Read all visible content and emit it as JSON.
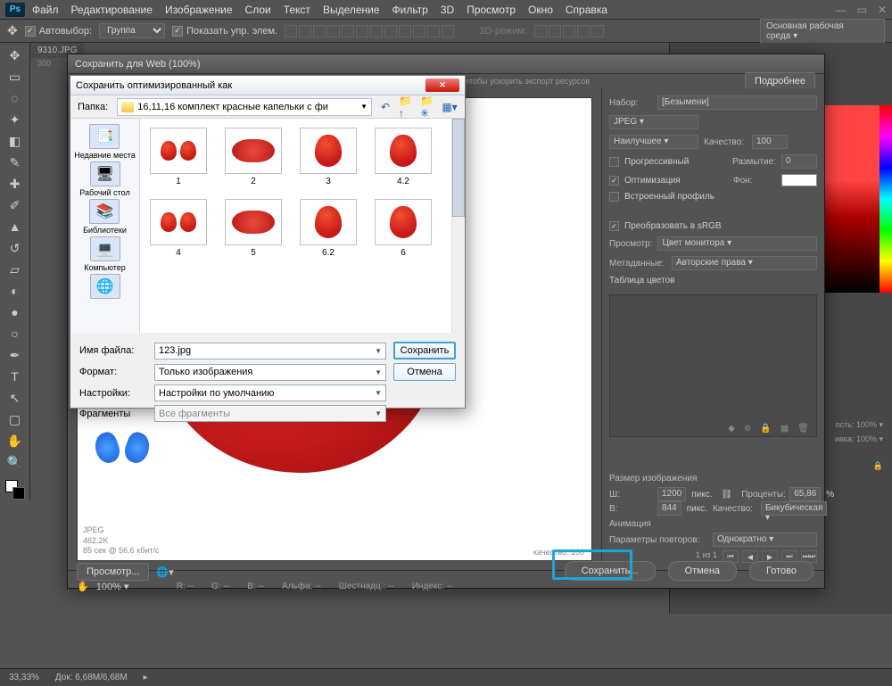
{
  "menu": [
    "Файл",
    "Редактирование",
    "Изображение",
    "Слои",
    "Текст",
    "Выделение",
    "Фильтр",
    "3D",
    "Просмотр",
    "Окно",
    "Справка"
  ],
  "optionsBar": {
    "autoselect": "Автовыбор:",
    "group": "Группа",
    "showControls": "Показать упр. элем.",
    "mode3d": "3D-режим:"
  },
  "workspace": "Основная рабочая среда",
  "docTab": "9310.JPG",
  "ruler": "300",
  "statusbar": {
    "zoom": "33,33%",
    "doc": "Док: 6,68M/6,68M"
  },
  "sfw": {
    "title": "Сохранить для Web (100%)",
    "meta": {
      "fmt": "JPEG",
      "size": "462,2K",
      "time": "85 сек @ 56.6 кбит/с"
    },
    "quality_lbl": "качество: 100",
    "zoom_lbl": "100%",
    "readouts": {
      "r": "R: --",
      "g": "G: --",
      "b": "B: --",
      "alpha": "Альфа: --",
      "hex": "Шестнадц.: --",
      "idx": "Индекс: --"
    },
    "footBtns": {
      "preview": "Просмотр...",
      "save": "Сохранить...",
      "cancel": "Отмена",
      "done": "Готово"
    },
    "side": {
      "preset_lbl": "Набор:",
      "preset_val": "[Безымени]",
      "format": "JPEG",
      "quality_mode": "Наилучшее",
      "quality_lbl2": "Качество:",
      "quality_val": "100",
      "progressive": "Прогрессивный",
      "blur_lbl": "Размытие:",
      "blur_val": "0",
      "optimized": "Оптимизация",
      "matte_lbl": "Фон:",
      "embed": "Встроенный профиль",
      "srgb": "Преобразовать в sRGB",
      "preview_lbl": "Просмотр:",
      "preview_val": "Цвет монитора",
      "meta_lbl": "Метаданные:",
      "meta_val": "Авторские права",
      "ct": "Таблица цветов",
      "img_size": "Размер изображения",
      "w_lbl": "Ш:",
      "w_val": "1200",
      "px": "пикс.",
      "pct_lbl": "Проценты:",
      "pct_val": "65,86",
      "pct_sign": "%",
      "h_lbl": "В:",
      "h_val": "844",
      "q_lbl": "Качество:",
      "q_val": "Бикубическая",
      "anim": "Анимация",
      "loop_lbl": "Параметры повторов:",
      "loop_val": "Однократно",
      "frame": "1 из 1"
    },
    "exportHint": "ли щелкните слой правой кнопкой мыши, чтобы ускорить экспорт ресурсов",
    "moreBtn": "Подробнее"
  },
  "winDlg": {
    "title": "Сохранить оптимизированный как",
    "folder_lbl": "Папка:",
    "folder_val": "16,11,16 комплект красные капельки с фи",
    "places": [
      "Недавние места",
      "Рабочий стол",
      "Библиотеки",
      "Компьютер"
    ],
    "thumbs": [
      "1",
      "2",
      "3",
      "4.2",
      "4",
      "5",
      "6.2",
      "6"
    ],
    "filename_lbl": "Имя файла:",
    "filename": "123.jpg",
    "format_lbl": "Формат:",
    "format": "Только изображения",
    "settings_lbl": "Настройки:",
    "settings": "Настройки по умолчанию",
    "frag_lbl": "Фрагменты",
    "frag": "Все фрагменты",
    "save": "Сохранить",
    "cancel": "Отмена"
  },
  "panelLabels": {
    "opacity": "ость:",
    "fill": "ивка:",
    "pct": "100%",
    "lock": "🔒"
  }
}
